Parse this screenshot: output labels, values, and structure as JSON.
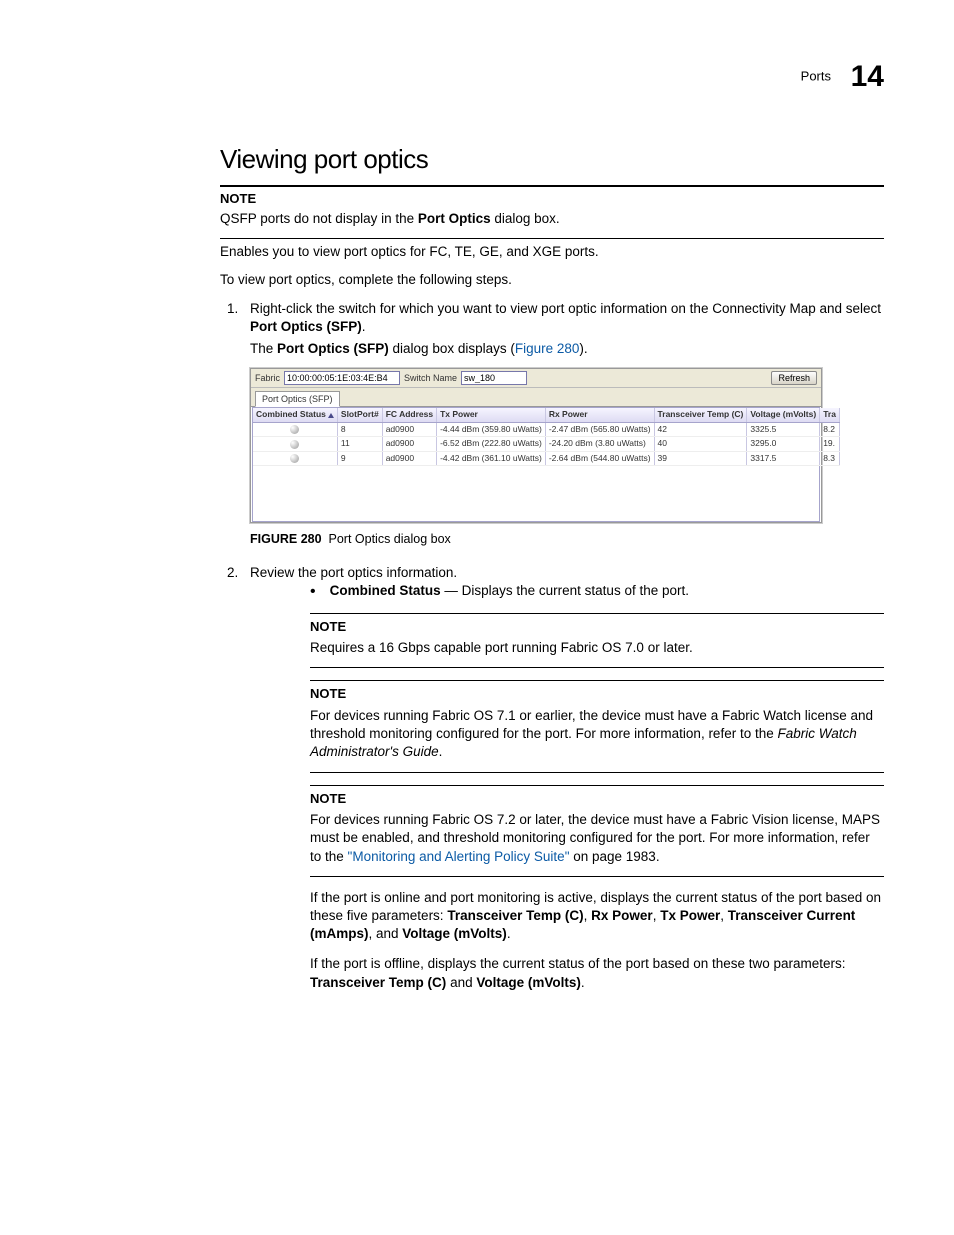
{
  "header": {
    "section": "Ports",
    "chapter": "14"
  },
  "title": "Viewing port optics",
  "note1": {
    "label": "NOTE",
    "text_a": "QSFP ports do not display in the ",
    "text_b": "Port Optics",
    "text_c": " dialog box."
  },
  "intro1": "Enables you to view port optics for FC, TE, GE, and XGE ports.",
  "intro2": "To view port optics, complete the following steps.",
  "step1": {
    "a": "Right-click the switch for which you want to view port optic information on the Connectivity Map and select ",
    "b": "Port Optics (SFP)",
    "c": ".",
    "sub_a": "The ",
    "sub_b": "Port Optics (SFP)",
    "sub_c": " dialog box displays (",
    "sub_link": "Figure 280",
    "sub_d": ")."
  },
  "dialog": {
    "fabric_label": "Fabric",
    "fabric_value": "10:00:00:05:1E:03:4E:B4",
    "switch_label": "Switch Name",
    "switch_value": "sw_180",
    "refresh": "Refresh",
    "tab": "Port Optics (SFP)",
    "columns": [
      "Combined Status",
      "SlotPort#",
      "FC Address",
      "Tx Power",
      "Rx Power",
      "Transceiver Temp (C)",
      "Voltage (mVolts)",
      "Tra"
    ],
    "rows": [
      {
        "slot": "8",
        "fc": "ad0900",
        "tx": "-4.44 dBm (359.80 uWatts)",
        "rx": "-2.47 dBm (565.80 uWatts)",
        "temp": "42",
        "volt": "3325.5",
        "tra": "8.2"
      },
      {
        "slot": "11",
        "fc": "ad0900",
        "tx": "-6.52 dBm (222.80 uWatts)",
        "rx": "-24.20 dBm (3.80 uWatts)",
        "temp": "40",
        "volt": "3295.0",
        "tra": "19."
      },
      {
        "slot": "9",
        "fc": "ad0900",
        "tx": "-4.42 dBm (361.10 uWatts)",
        "rx": "-2.64 dBm (544.80 uWatts)",
        "temp": "39",
        "volt": "3317.5",
        "tra": "8.3"
      }
    ]
  },
  "figcap": {
    "label": "FIGURE 280",
    "text": "Port Optics dialog box"
  },
  "step2": "Review the port optics information.",
  "bullet1": {
    "b": "Combined Status",
    "rest": " — Displays the current status of the port."
  },
  "noteA": {
    "label": "NOTE",
    "text": "Requires a 16 Gbps capable port running Fabric OS 7.0 or later."
  },
  "noteB": {
    "label": "NOTE",
    "a": "For devices running Fabric OS 7.1 or earlier, the device must have a Fabric Watch license and threshold monitoring configured for the port. For more information, refer to the ",
    "i": "Fabric Watch Administrator's Guide",
    "c": "."
  },
  "noteC": {
    "label": "NOTE",
    "a": "For devices running Fabric OS 7.2 or later, the device must have a Fabric Vision license, MAPS must be enabled, and threshold monitoring configured for the port. For more information, refer to the ",
    "link": "\"Monitoring and Alerting Policy Suite\"",
    "c": " on page 1983."
  },
  "para1": {
    "a": "If the port is online and port monitoring is active, displays the current status of the port based on these five parameters: ",
    "b1": "Transceiver Temp (C)",
    "s1": ", ",
    "b2": "Rx Power",
    "s2": ", ",
    "b3": "Tx Power",
    "s3": ", ",
    "b4": "Transceiver Current (mAmps)",
    "s4": ", and ",
    "b5": "Voltage (mVolts)",
    "s5": "."
  },
  "para2": {
    "a": "If the port is offline, displays the current status of the port based on these two parameters: ",
    "b1": "Transceiver Temp (C)",
    "s1": " and ",
    "b2": "Voltage (mVolts)",
    "s2": "."
  }
}
